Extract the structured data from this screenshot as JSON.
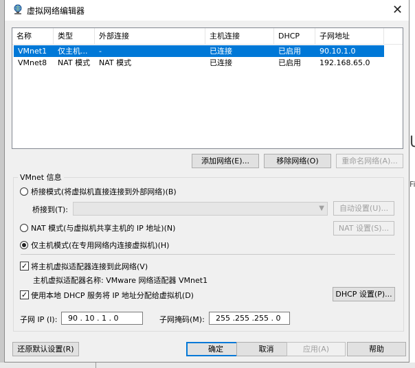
{
  "window": {
    "title": "虚拟网络编辑器",
    "close_glyph": "✕"
  },
  "background": {
    "fragment_large": "U",
    "fragment_small": "Fi"
  },
  "network_table": {
    "columns": [
      "名称",
      "类型",
      "外部连接",
      "主机连接",
      "DHCP",
      "子网地址"
    ],
    "rows": [
      {
        "name": "VMnet1",
        "type": "仅主机...",
        "external": "-",
        "host": "已连接",
        "dhcp": "已启用",
        "subnet": "90.10.1.0",
        "selected": true
      },
      {
        "name": "VMnet8",
        "type": "NAT 模式",
        "external": "NAT 模式",
        "host": "已连接",
        "dhcp": "已启用",
        "subnet": "192.168.65.0",
        "selected": false
      }
    ]
  },
  "table_buttons": {
    "add": "添加网络(E)...",
    "remove": "移除网络(O)",
    "rename": "重命名网络(A)..."
  },
  "vmnet_info": {
    "group_label": "VMnet 信息",
    "bridge_mode": "桥接模式(将虚拟机直接连接到外部网络)(B)",
    "bridge_to_label": "桥接到(T):",
    "bridge_to_value": "",
    "auto_settings": "自动设置(U)...",
    "nat_mode": "NAT 模式(与虚拟机共享主机的 IP 地址)(N)",
    "nat_settings": "NAT 设置(S)...",
    "host_only_mode": "仅主机模式(在专用网络内连接虚拟机)(H)",
    "selected_mode": "host-only",
    "connect_host_adapter": "将主机虚拟适配器连接到此网络(V)",
    "connect_host_adapter_checked": true,
    "adapter_name": "主机虚拟适配器名称: VMware 网络适配器 VMnet1",
    "use_dhcp": "使用本地 DHCP 服务将 IP 地址分配给虚拟机(D)",
    "use_dhcp_checked": true,
    "dhcp_settings": "DHCP 设置(P)...",
    "subnet_ip_label": "子网 IP (I):",
    "subnet_ip_value": "90 . 10 . 1 . 0",
    "subnet_mask_label": "子网掩码(M):",
    "subnet_mask_value": "255 .255 .255 . 0"
  },
  "footer": {
    "restore_defaults": "还原默认设置(R)",
    "ok": "确定",
    "cancel": "取消",
    "apply": "应用(A)",
    "help": "帮助"
  },
  "colors": {
    "selection": "#0078d7",
    "dialog_bg": "#f0f0f0",
    "default_button_border": "#0078d7"
  }
}
